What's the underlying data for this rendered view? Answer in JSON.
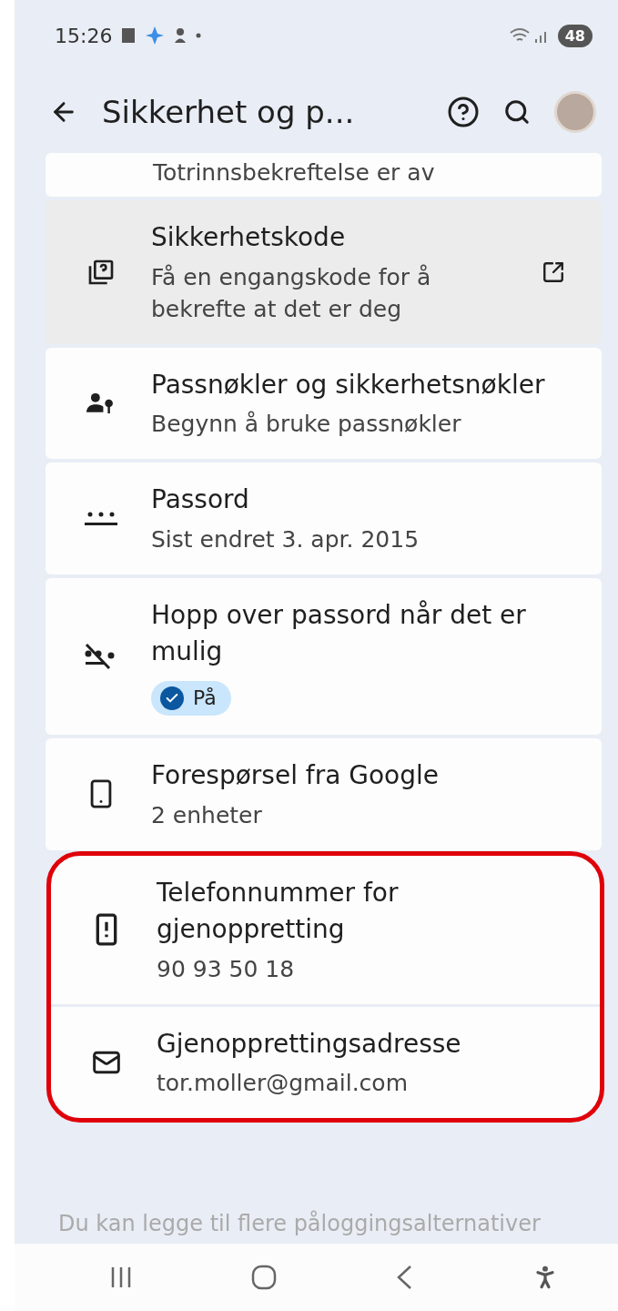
{
  "status_bar": {
    "time": "15:26",
    "battery": "48"
  },
  "toolbar": {
    "title": "Sikkerhet og p..."
  },
  "cards": [
    {
      "outlined": false,
      "items": [
        {
          "kind": "cut",
          "subtitle": "Totrinnsbekreftelse er av",
          "selected": false
        }
      ]
    },
    {
      "outlined": false,
      "items": [
        {
          "kind": "external",
          "title": "Sikkerhetskode",
          "subtitle": "Få en engangskode for å bekrefte at det er deg",
          "selected": true
        }
      ]
    },
    {
      "outlined": false,
      "items": [
        {
          "kind": "plain",
          "title": "Passnøkler og sikkerhetsnøkler",
          "subtitle": "Begynn å bruke passnøkler",
          "selected": false
        }
      ]
    },
    {
      "outlined": false,
      "items": [
        {
          "kind": "plain",
          "title": "Passord",
          "subtitle": "Sist endret 3. apr. 2015",
          "selected": false
        }
      ]
    },
    {
      "outlined": false,
      "items": [
        {
          "kind": "chip",
          "title": "Hopp over passord når det er mulig",
          "chip": {
            "label": "På",
            "on": true
          },
          "selected": false
        }
      ]
    },
    {
      "outlined": false,
      "items": [
        {
          "kind": "plain",
          "title": "Forespørsel fra Google",
          "subtitle": "2 enheter",
          "selected": false
        }
      ]
    },
    {
      "outlined": true,
      "items": [
        {
          "kind": "plain",
          "title": "Telefonnummer for gjenoppretting",
          "subtitle": "90 93 50 18",
          "selected": false
        },
        {
          "kind": "plain",
          "title": "Gjenopprettingsadresse",
          "subtitle": "tor.moller@gmail.com",
          "selected": false
        }
      ]
    }
  ],
  "footer_text": "Du kan legge til flere påloggingsalternativer"
}
